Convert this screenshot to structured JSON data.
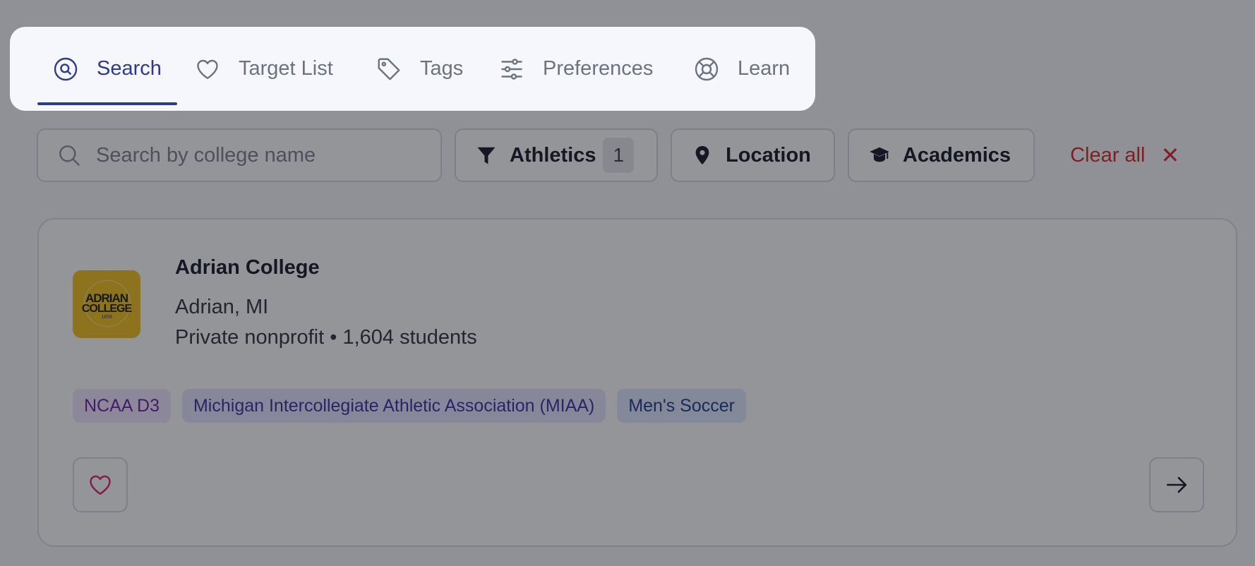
{
  "tabs": [
    {
      "label": "Search",
      "icon": "search-circle-icon",
      "active": true
    },
    {
      "label": "Target List",
      "icon": "heart-icon",
      "active": false
    },
    {
      "label": "Tags",
      "icon": "tag-icon",
      "active": false
    },
    {
      "label": "Preferences",
      "icon": "sliders-icon",
      "active": false
    },
    {
      "label": "Learn",
      "icon": "lifebuoy-icon",
      "active": false
    }
  ],
  "search": {
    "placeholder": "Search by college name",
    "value": ""
  },
  "filters": {
    "athletics": {
      "label": "Athletics",
      "count": "1",
      "icon": "funnel-icon"
    },
    "location": {
      "label": "Location",
      "icon": "map-pin-icon"
    },
    "academics": {
      "label": "Academics",
      "icon": "graduation-cap-icon"
    },
    "clear_all": {
      "label": "Clear all",
      "icon": "close-icon",
      "symbol": "✕"
    }
  },
  "results": [
    {
      "name": "Adrian College",
      "location": "Adrian, MI",
      "meta": "Private nonprofit • 1,604 students",
      "logo": {
        "line1": "ADRIAN",
        "line2": "COLLEGE",
        "line3": "1859"
      },
      "tags": [
        "NCAA D3",
        "Michigan Intercollegiate Athletic Association (MIAA)",
        "Men's Soccer"
      ]
    }
  ],
  "colors": {
    "accent": "#2e3a8c",
    "danger": "#dc2626",
    "favorite": "#db2777",
    "logo_bg": "#f2c01c",
    "overlay": "rgba(22,24,32,0.46)"
  }
}
